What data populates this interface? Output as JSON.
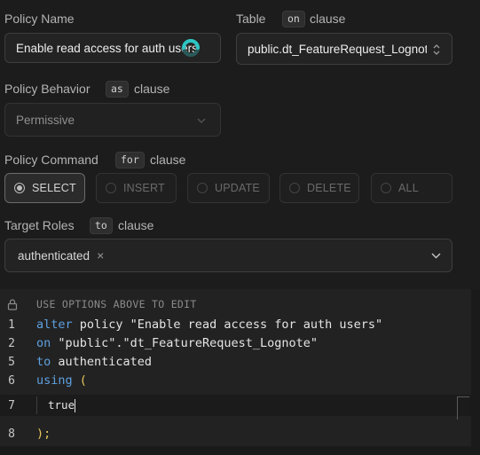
{
  "policy_name": {
    "label": "Policy Name",
    "value": "Enable read access for auth users"
  },
  "table": {
    "label": "Table",
    "clause_keyword": "on",
    "clause_word": "clause",
    "value": "public.dt_FeatureRequest_Lognote"
  },
  "behavior": {
    "label": "Policy Behavior",
    "clause_keyword": "as",
    "clause_word": "clause",
    "value": "Permissive"
  },
  "command": {
    "label": "Policy Command",
    "clause_keyword": "for",
    "clause_word": "clause",
    "options": [
      "SELECT",
      "INSERT",
      "UPDATE",
      "DELETE",
      "ALL"
    ],
    "selected": "SELECT"
  },
  "roles": {
    "label": "Target Roles",
    "clause_keyword": "to",
    "clause_word": "clause",
    "selected_role": "authenticated",
    "remove_glyph": "×"
  },
  "editor": {
    "notice": "USE OPTIONS ABOVE TO EDIT",
    "lines": [
      {
        "num": "1",
        "kw": "alter",
        "rest": " policy \"Enable read access for auth users\""
      },
      {
        "num": "2",
        "kw": "on",
        "rest": " \"public\".\"dt_FeatureRequest_Lognote\""
      },
      {
        "num": "5",
        "kw": "to",
        "rest": " authenticated"
      },
      {
        "num": "6",
        "kw": "using",
        "rest": " ("
      },
      {
        "num": "7",
        "kw": "",
        "rest": "true"
      },
      {
        "num": "8",
        "kw": "",
        "rest": ");"
      }
    ]
  },
  "colors": {
    "background": "#1c1c1c",
    "keyword": "#5ea1e0",
    "paren": "#e6c65c",
    "spinner_accent": "#2ec4c4"
  }
}
